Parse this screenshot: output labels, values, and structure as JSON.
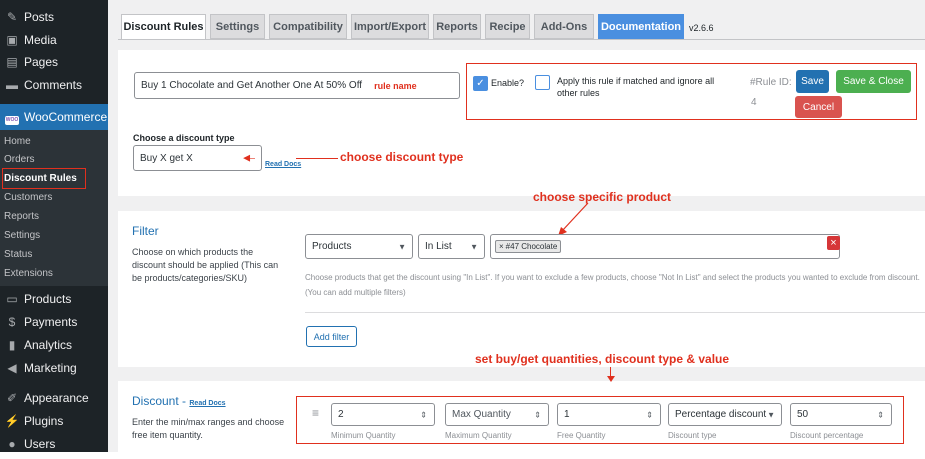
{
  "sidebar": {
    "top_items": [
      {
        "label": "Posts",
        "icon": "pin-icon"
      },
      {
        "label": "Media",
        "icon": "media-icon"
      },
      {
        "label": "Pages",
        "icon": "pages-icon"
      },
      {
        "label": "Comments",
        "icon": "comments-icon"
      }
    ],
    "woocommerce": {
      "label": "WooCommerce",
      "badge": "WOO"
    },
    "sub_items": [
      "Home",
      "Orders",
      "Discount Rules",
      "Customers",
      "Reports",
      "Settings",
      "Status",
      "Extensions"
    ],
    "bottom_items": [
      {
        "label": "Products",
        "icon": "products-icon"
      },
      {
        "label": "Payments",
        "icon": "payments-icon"
      },
      {
        "label": "Analytics",
        "icon": "analytics-icon"
      },
      {
        "label": "Marketing",
        "icon": "marketing-icon"
      },
      {
        "label": "Appearance",
        "icon": "appearance-icon"
      },
      {
        "label": "Plugins",
        "icon": "plugins-icon"
      },
      {
        "label": "Users",
        "icon": "users-icon"
      }
    ]
  },
  "tabs": [
    "Discount Rules",
    "Settings",
    "Compatibility",
    "Import/Export",
    "Reports",
    "Recipe",
    "Add-Ons",
    "Documentation"
  ],
  "version": "v2.6.6",
  "rule": {
    "name": "Buy 1 Chocolate and Get Another One At 50% Off",
    "name_annotation": "rule name",
    "enable_label": "Enable?",
    "apply_label": "Apply this rule if matched and ignore all other rules",
    "rule_id_label": "#Rule ID:",
    "rule_id_value": "4",
    "save": "Save",
    "save_close": "Save & Close",
    "cancel": "Cancel"
  },
  "discount_type": {
    "label": "Choose a discount type",
    "value": "Buy X get X",
    "read_docs": "Read Docs",
    "annotation": "choose discount type"
  },
  "filter": {
    "title": "Filter",
    "description": "Choose on which products the discount should be applied (This can be products/categories/SKU)",
    "type": "Products",
    "operator": "In List",
    "chip_remove": "×",
    "product_chip": "#47 Chocolate",
    "remove_icon": "×",
    "help": "Choose products that get the discount using \"In List\". If you want to exclude a few products, choose \"Not In List\" and select the products you wanted to exclude from discount. (You can add multiple filters)",
    "add_filter": "Add filter",
    "annotation": "choose specific product"
  },
  "discount": {
    "title": "Discount",
    "title_sep": "-",
    "read_docs": "Read Docs",
    "description": "Enter the min/max ranges and choose free item quantity.",
    "annotation": "set buy/get quantities, discount type & value",
    "drag_icon": "≡",
    "fields": [
      {
        "value": "2",
        "caption": "Minimum Quantity"
      },
      {
        "value": "Max Quantity",
        "caption": "Maximum Quantity"
      },
      {
        "value": "1",
        "caption": "Free Quantity"
      },
      {
        "value": "Percentage discount",
        "caption": "Discount type"
      },
      {
        "value": "50",
        "caption": "Discount percentage"
      }
    ]
  },
  "colors": {
    "sidebar_bg": "#1d2327",
    "woocommerce_active": "#2271b1",
    "save_button": "#2271b1",
    "save_close_button": "#4caf50",
    "cancel_button": "#d9534f",
    "annotation_red": "#e0301e",
    "documentation_tab": "#4a8fe0"
  }
}
